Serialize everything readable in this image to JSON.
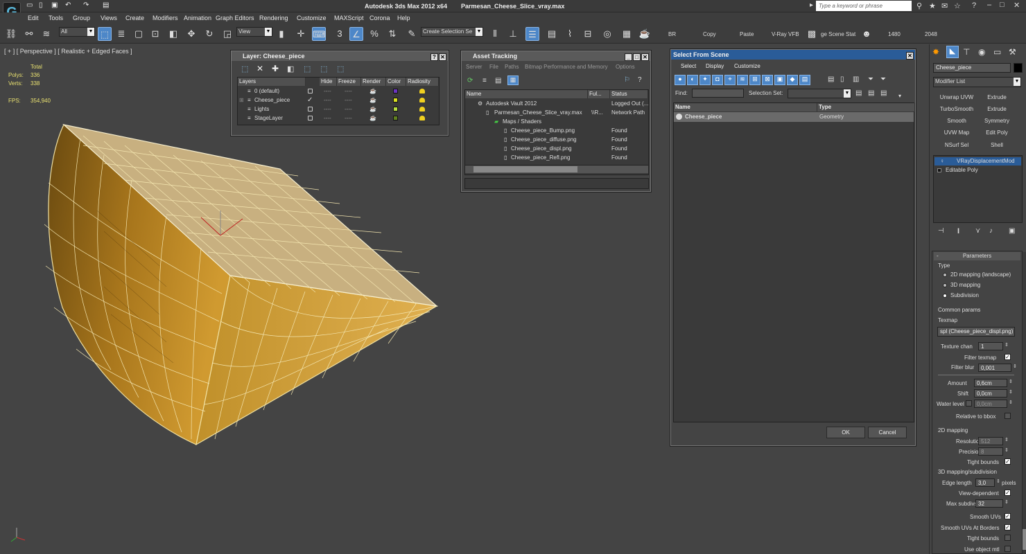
{
  "app": {
    "title": "Autodesk 3ds Max  2012 x64",
    "file": "Parmesan_Cheese_Slice_vray.max",
    "search_placeholder": "Type a keyword or phrase"
  },
  "menu": [
    "Edit",
    "Tools",
    "Group",
    "Views",
    "Create",
    "Modifiers",
    "Animation",
    "Graph Editors",
    "Rendering",
    "Customize",
    "MAXScript",
    "Corona",
    "Help"
  ],
  "toolbar": {
    "filter": "All",
    "ref_coord": "View",
    "selection_set": "Create Selection Se",
    "br": "BR",
    "copy": "Copy",
    "paste": "Paste",
    "vray_vfb": "V-Ray VFB",
    "scene_states": "ge Scene Stat",
    "width": "1480",
    "height": "2048"
  },
  "viewport": {
    "label": "[ + ] [ Perspective ] [ Realistic + Edged Faces ]",
    "stats": {
      "total_label": "Total",
      "polys_label": "Polys:",
      "polys": "336",
      "verts_label": "Verts:",
      "verts": "338",
      "fps_label": "FPS:",
      "fps": "354,940"
    }
  },
  "layer_dialog": {
    "title": "Layer: Cheese_piece",
    "columns": [
      "Layers",
      "Hide",
      "Freeze",
      "Render",
      "Color",
      "Radiosity"
    ],
    "rows": [
      {
        "name": "0 (default)",
        "color": "#6a34c0"
      },
      {
        "name": "Cheese_piece",
        "color": "#d8e020"
      },
      {
        "name": "Lights",
        "color": "#b8e040"
      },
      {
        "name": "StageLayer",
        "color": "#608020"
      }
    ]
  },
  "asset_tracking": {
    "title": "Asset Tracking",
    "menu": [
      "Server",
      "File",
      "Paths",
      "Bitmap Performance and Memory",
      "Options"
    ],
    "columns": [
      "Name",
      "Ful...",
      "Status"
    ],
    "rows": [
      {
        "name": "Autodesk Vault 2012",
        "full": "",
        "status": "Logged Out (..."
      },
      {
        "name": "Parmesan_Cheese_Slice_vray.max",
        "full": "\\\\R...",
        "status": "Network Path"
      },
      {
        "name": "Maps / Shaders",
        "full": "",
        "status": ""
      },
      {
        "name": "Cheese_piece_Bump.png",
        "full": "",
        "status": "Found"
      },
      {
        "name": "Cheese_piece_diffuse.png",
        "full": "",
        "status": "Found"
      },
      {
        "name": "Cheese_piece_displ.png",
        "full": "",
        "status": "Found"
      },
      {
        "name": "Cheese_piece_Refl.png",
        "full": "",
        "status": "Found"
      }
    ]
  },
  "select_from_scene": {
    "title": "Select From Scene",
    "menu": [
      "Select",
      "Display",
      "Customize"
    ],
    "find_label": "Find:",
    "selection_set_label": "Selection Set:",
    "columns": [
      "Name",
      "Type"
    ],
    "rows": [
      {
        "name": "Cheese_piece",
        "type": "Geometry"
      }
    ],
    "ok": "OK",
    "cancel": "Cancel"
  },
  "command_panel": {
    "object_name": "Cheese_piece",
    "modifier_list": "Modifier List",
    "mod_buttons": [
      "Unwrap UVW",
      "Extrude",
      "TurboSmooth",
      "Extrude",
      "Smooth",
      "Symmetry",
      "UVW Map",
      "Edit Poly",
      "NSurf Sel",
      "Shell"
    ],
    "stack": [
      "VRayDisplacementMod",
      "Editable Poly"
    ],
    "params": {
      "rollout": "Parameters",
      "type_group": "Type",
      "types": [
        "2D mapping (landscape)",
        "3D mapping",
        "Subdivision"
      ],
      "common_group": "Common params",
      "texmap_label": "Texmap",
      "texmap": "spl (Cheese_piece_displ.png)",
      "texture_chan_label": "Texture chan",
      "texture_chan": "1",
      "filter_texmap_label": "Filter texmap",
      "filter_blur_label": "Filter blur",
      "filter_blur": "0,001",
      "amount_label": "Amount",
      "amount": "0,6cm",
      "shift_label": "Shift",
      "shift": "0,0cm",
      "water_level_label": "Water level",
      "water_level": "0,0cm",
      "relative_label": "Relative to bbox",
      "mapping2d_group": "2D mapping",
      "resolution_label": "Resolution",
      "resolution": "512",
      "precision_label": "Precision",
      "precision": "8",
      "tight_bounds_label": "Tight bounds",
      "mapping3d_group": "3D mapping/subdivision",
      "edge_length_label": "Edge length",
      "edge_length": "3,0",
      "pixels": "pixels",
      "view_dependent_label": "View-dependent",
      "max_subdivs_label": "Max subdivs",
      "max_subdivs": "32",
      "smooth_uvs_label": "Smooth UVs",
      "smooth_uvs_borders_label": "Smooth UVs At Borders",
      "tight_bounds2_label": "Tight bounds",
      "use_object_mtl_label": "Use object mtl"
    }
  }
}
